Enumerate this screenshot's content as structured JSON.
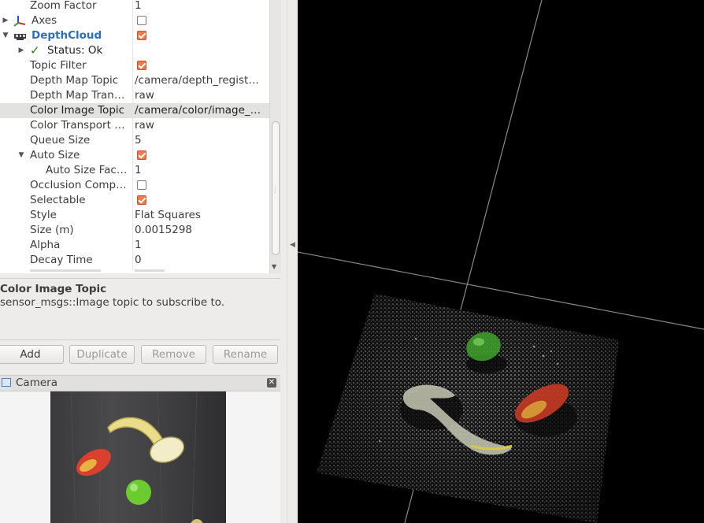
{
  "displays": {
    "rows": [
      {
        "name": "Zoom Factor",
        "value": "1"
      },
      {
        "name": "Axes"
      },
      {
        "name": "DepthCloud"
      },
      {
        "name": "Status: Ok"
      },
      {
        "name": "Topic Filter"
      },
      {
        "name": "Depth Map Topic",
        "value": "/camera/depth_regist…"
      },
      {
        "name": "Depth Map Tran…",
        "value": "raw"
      },
      {
        "name": "Color Image Topic",
        "value": "/camera/color/image_…"
      },
      {
        "name": "Color Transport …",
        "value": "raw"
      },
      {
        "name": "Queue Size",
        "value": "5"
      },
      {
        "name": "Auto Size"
      },
      {
        "name": "Auto Size Fac…",
        "value": "1"
      },
      {
        "name": "Occlusion Comp…"
      },
      {
        "name": "Selectable"
      },
      {
        "name": "Style",
        "value": "Flat Squares"
      },
      {
        "name": "Size (m)",
        "value": "0.0015298"
      },
      {
        "name": "Alpha",
        "value": "1"
      },
      {
        "name": "Decay Time",
        "value": "0"
      }
    ],
    "checkboxes": {
      "axes": false,
      "depthcloud": true,
      "topic_filter": true,
      "auto_size": true,
      "occlusion": false,
      "selectable": true
    }
  },
  "description": {
    "title": "Color Image Topic",
    "text": "sensor_msgs::Image topic to subscribe to."
  },
  "buttons": {
    "add": "Add",
    "duplicate": "Duplicate",
    "remove": "Remove",
    "rename": "Rename"
  },
  "camera_panel": {
    "title": "Camera"
  },
  "colors": {
    "checkbox_checked": "#ee7a4c",
    "display_name_blue": "#2a6fc4",
    "selected_row": "#e2e2e0",
    "render_background": "#000000",
    "grid_line": "#8a8a8a"
  }
}
